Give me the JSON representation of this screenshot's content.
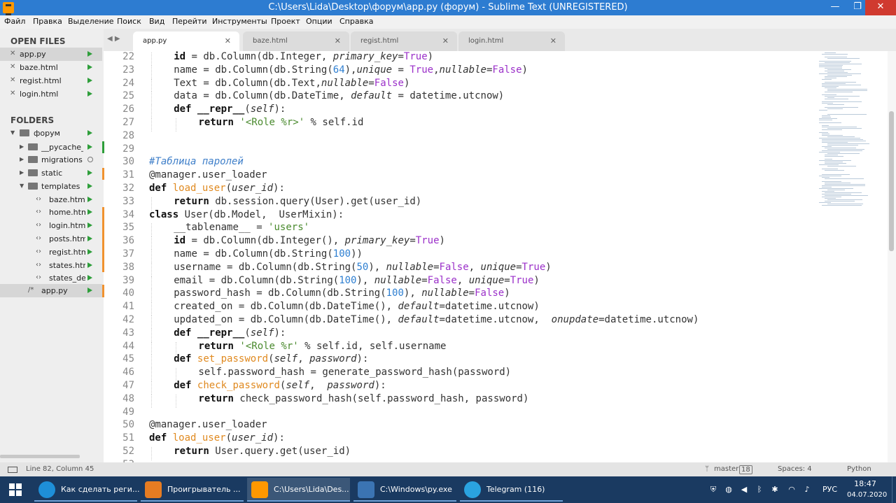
{
  "window": {
    "title": "C:\\Users\\Lida\\Desktop\\форум\\app.py (форум) - Sublime Text (UNREGISTERED)",
    "minimize": "—",
    "maximize": "❐",
    "close": "✕"
  },
  "menu": [
    "Файл",
    "Правка",
    "Выделение",
    "Поиск",
    "Вид",
    "Перейти",
    "Инструменты",
    "Проект",
    "Опции",
    "Справка"
  ],
  "sidebar": {
    "open_files_heading": "OPEN FILES",
    "open_files": [
      {
        "name": "app.py",
        "active": true
      },
      {
        "name": "baze.html"
      },
      {
        "name": "regist.html"
      },
      {
        "name": "login.html"
      }
    ],
    "folders_heading": "FOLDERS",
    "tree": [
      {
        "name": "форум",
        "type": "folder-open",
        "level": 0,
        "status": "modified"
      },
      {
        "name": "__pycache__",
        "type": "folder",
        "level": 1,
        "status": "modified"
      },
      {
        "name": "migrations",
        "type": "folder",
        "level": 1,
        "status": "untracked"
      },
      {
        "name": "static",
        "type": "folder",
        "level": 1,
        "status": "modified"
      },
      {
        "name": "templates",
        "type": "folder-open",
        "level": 1,
        "status": "modified"
      },
      {
        "name": "baze.html",
        "type": "file",
        "level": 2,
        "status": "modified"
      },
      {
        "name": "home.htm",
        "type": "file",
        "level": 2,
        "status": "modified"
      },
      {
        "name": "login.html",
        "type": "file",
        "level": 2,
        "status": "modified"
      },
      {
        "name": "posts.html",
        "type": "file",
        "level": 2,
        "status": "modified"
      },
      {
        "name": "regist.html",
        "type": "file",
        "level": 2,
        "status": "modified"
      },
      {
        "name": "states.htm",
        "type": "file",
        "level": 2,
        "status": "modified"
      },
      {
        "name": "states_det",
        "type": "file",
        "level": 2,
        "status": "modified"
      },
      {
        "name": "app.py",
        "type": "pyfile",
        "level": 1,
        "status": "modified",
        "active": true
      }
    ]
  },
  "tabs": [
    {
      "label": "app.py",
      "active": true
    },
    {
      "label": "baze.html"
    },
    {
      "label": "regist.html"
    },
    {
      "label": "login.html"
    }
  ],
  "editor": {
    "lines": [
      {
        "n": "22",
        "indent": 1,
        "tokens": [
          [
            "id",
            "kw"
          ],
          [
            " = db.Column(db.Integer, ",
            ""
          ],
          [
            "primary_key",
            "it"
          ],
          [
            "=",
            ""
          ],
          [
            "True",
            "cons"
          ],
          [
            ")",
            ""
          ]
        ]
      },
      {
        "n": "23",
        "indent": 1,
        "tokens": [
          [
            "name = db.Column(db.String(",
            ""
          ],
          [
            "64",
            "num"
          ],
          [
            "),",
            ""
          ],
          [
            "unique",
            "it"
          ],
          [
            " = ",
            ""
          ],
          [
            "True",
            "cons"
          ],
          [
            ",",
            ""
          ],
          [
            "nullable",
            "it"
          ],
          [
            "=",
            ""
          ],
          [
            "False",
            "cons"
          ],
          [
            ")",
            ""
          ]
        ]
      },
      {
        "n": "24",
        "indent": 1,
        "tokens": [
          [
            "Text = db.Column(db.Text,",
            ""
          ],
          [
            "nullable",
            "it"
          ],
          [
            "=",
            ""
          ],
          [
            "False",
            "cons"
          ],
          [
            ")",
            ""
          ]
        ]
      },
      {
        "n": "25",
        "indent": 1,
        "tokens": [
          [
            "data = db.Column(db.DateTime, ",
            ""
          ],
          [
            "default",
            "it"
          ],
          [
            " = datetime.utcnow)",
            ""
          ]
        ]
      },
      {
        "n": "26",
        "indent": 1,
        "tokens": [
          [
            "def ",
            "kw"
          ],
          [
            "__repr__",
            "kw"
          ],
          [
            "(",
            ""
          ],
          [
            "self",
            "it"
          ],
          [
            "):",
            ""
          ]
        ]
      },
      {
        "n": "27",
        "indent": 2,
        "tokens": [
          [
            "return ",
            "kw"
          ],
          [
            "'<Role %r>'",
            "str"
          ],
          [
            " % self.id",
            ""
          ]
        ]
      },
      {
        "n": "28",
        "indent": 0,
        "tokens": []
      },
      {
        "n": "29",
        "indent": 0,
        "tokens": []
      },
      {
        "n": "30",
        "indent": 0,
        "tokens": [
          [
            "#Таблица паролей",
            "cm"
          ]
        ]
      },
      {
        "n": "31",
        "indent": 0,
        "tokens": [
          [
            "@manager.user_loader",
            "dec"
          ]
        ]
      },
      {
        "n": "32",
        "indent": 0,
        "tokens": [
          [
            "def ",
            "kw"
          ],
          [
            "load_user",
            "fn"
          ],
          [
            "(",
            ""
          ],
          [
            "user_id",
            "it"
          ],
          [
            "):",
            ""
          ]
        ]
      },
      {
        "n": "33",
        "indent": 1,
        "tokens": [
          [
            "return ",
            "kw"
          ],
          [
            "db.session.query(User).get(user_id)",
            ""
          ]
        ]
      },
      {
        "n": "34",
        "indent": 0,
        "tokens": [
          [
            "class ",
            "kw"
          ],
          [
            "User(db.Model,  UserMixin):",
            ""
          ]
        ]
      },
      {
        "n": "35",
        "indent": 1,
        "tokens": [
          [
            "__tablename__ = ",
            ""
          ],
          [
            "'users'",
            "str"
          ]
        ]
      },
      {
        "n": "36",
        "indent": 1,
        "tokens": [
          [
            "id",
            "kw"
          ],
          [
            " = db.Column(db.Integer(), ",
            ""
          ],
          [
            "primary_key",
            "it"
          ],
          [
            "=",
            ""
          ],
          [
            "True",
            "cons"
          ],
          [
            ")",
            ""
          ]
        ]
      },
      {
        "n": "37",
        "indent": 1,
        "tokens": [
          [
            "name = db.Column(db.String(",
            ""
          ],
          [
            "100",
            "num"
          ],
          [
            "))",
            ""
          ]
        ]
      },
      {
        "n": "38",
        "indent": 1,
        "tokens": [
          [
            "username = db.Column(db.String(",
            ""
          ],
          [
            "50",
            "num"
          ],
          [
            "), ",
            ""
          ],
          [
            "nullable",
            "it"
          ],
          [
            "=",
            ""
          ],
          [
            "False",
            "cons"
          ],
          [
            ", ",
            ""
          ],
          [
            "unique",
            "it"
          ],
          [
            "=",
            ""
          ],
          [
            "True",
            "cons"
          ],
          [
            ")",
            ""
          ]
        ]
      },
      {
        "n": "39",
        "indent": 1,
        "tokens": [
          [
            "email = db.Column(db.String(",
            ""
          ],
          [
            "100",
            "num"
          ],
          [
            "), ",
            ""
          ],
          [
            "nullable",
            "it"
          ],
          [
            "=",
            ""
          ],
          [
            "False",
            "cons"
          ],
          [
            ", ",
            ""
          ],
          [
            "unique",
            "it"
          ],
          [
            "=",
            ""
          ],
          [
            "True",
            "cons"
          ],
          [
            ")",
            ""
          ]
        ]
      },
      {
        "n": "40",
        "indent": 1,
        "tokens": [
          [
            "password_hash = db.Column(db.String(",
            ""
          ],
          [
            "100",
            "num"
          ],
          [
            "), ",
            ""
          ],
          [
            "nullable",
            "it"
          ],
          [
            "=",
            ""
          ],
          [
            "False",
            "cons"
          ],
          [
            ")",
            ""
          ]
        ]
      },
      {
        "n": "41",
        "indent": 1,
        "tokens": [
          [
            "created_on = db.Column(db.DateTime(), ",
            ""
          ],
          [
            "default",
            "it"
          ],
          [
            "=datetime.utcnow)",
            ""
          ]
        ]
      },
      {
        "n": "42",
        "indent": 1,
        "tokens": [
          [
            "updated_on = db.Column(db.DateTime(), ",
            ""
          ],
          [
            "default",
            "it"
          ],
          [
            "=datetime.utcnow,  ",
            ""
          ],
          [
            "onupdate",
            "it"
          ],
          [
            "=datetime.utcnow)",
            ""
          ]
        ]
      },
      {
        "n": "43",
        "indent": 1,
        "tokens": [
          [
            "def ",
            "kw"
          ],
          [
            "__repr__",
            "kw"
          ],
          [
            "(",
            ""
          ],
          [
            "self",
            "it"
          ],
          [
            "):",
            ""
          ]
        ]
      },
      {
        "n": "44",
        "indent": 2,
        "tokens": [
          [
            "return ",
            "kw"
          ],
          [
            "'<Role %r'",
            "str"
          ],
          [
            " % self.id, self.username",
            ""
          ]
        ]
      },
      {
        "n": "45",
        "indent": 1,
        "tokens": [
          [
            "def ",
            "kw"
          ],
          [
            "set_password",
            "fn"
          ],
          [
            "(",
            ""
          ],
          [
            "self",
            "it"
          ],
          [
            ", ",
            ""
          ],
          [
            "password",
            "it"
          ],
          [
            "):",
            ""
          ]
        ]
      },
      {
        "n": "46",
        "indent": 2,
        "tokens": [
          [
            "self.password_hash = generate_password_hash(password)",
            ""
          ]
        ]
      },
      {
        "n": "47",
        "indent": 1,
        "tokens": [
          [
            "def ",
            "kw"
          ],
          [
            "check_password",
            "fn"
          ],
          [
            "(",
            ""
          ],
          [
            "self",
            "it"
          ],
          [
            ",  ",
            ""
          ],
          [
            "password",
            "it"
          ],
          [
            "):",
            ""
          ]
        ]
      },
      {
        "n": "48",
        "indent": 2,
        "tokens": [
          [
            "return ",
            "kw"
          ],
          [
            "check_password_hash(self.password_hash, password)",
            ""
          ]
        ]
      },
      {
        "n": "49",
        "indent": 0,
        "tokens": []
      },
      {
        "n": "50",
        "indent": 0,
        "tokens": [
          [
            "@manager.user_loader",
            "dec"
          ]
        ]
      },
      {
        "n": "51",
        "indent": 0,
        "tokens": [
          [
            "def ",
            "kw"
          ],
          [
            "load_user",
            "fn"
          ],
          [
            "(",
            ""
          ],
          [
            "user_id",
            "it"
          ],
          [
            "):",
            ""
          ]
        ]
      },
      {
        "n": "52",
        "indent": 1,
        "tokens": [
          [
            "return ",
            "kw"
          ],
          [
            "User.query.get(user_id)",
            ""
          ]
        ]
      },
      {
        "n": "53",
        "indent": 0,
        "tokens": []
      }
    ]
  },
  "status": {
    "position": "Line 82, Column 45",
    "branch": "master",
    "branch_count": "18",
    "spaces": "Spaces: 4",
    "syntax": "Python"
  },
  "taskbar": {
    "tasks": [
      {
        "label": "Как сделать реги...",
        "icon": "edge-icon",
        "color": "#1e8fd8"
      },
      {
        "label": "Проигрыватель ...",
        "icon": "media-player-icon",
        "color": "#e67c22"
      },
      {
        "label": "C:\\Users\\Lida\\Des...",
        "icon": "sublime-icon",
        "color": "#ff9800",
        "active": true
      },
      {
        "label": "C:\\Windows\\py.exe",
        "icon": "python-icon",
        "color": "#3b74b3"
      },
      {
        "label": "Telegram (116)",
        "icon": "telegram-icon",
        "color": "#2aa3e0"
      }
    ],
    "language": "РУС",
    "time": "18:47",
    "date": "04.07.2020"
  },
  "colors": {
    "titlebar": "#2d7cd1",
    "keyword": "#111111",
    "function": "#e08a20",
    "string": "#4a8a2e",
    "constant": "#9b30c9",
    "number": "#2e7fd1",
    "git_modified": "#2e9e3a",
    "change_orange": "#f0922f",
    "change_green": "#2e9e3a"
  }
}
